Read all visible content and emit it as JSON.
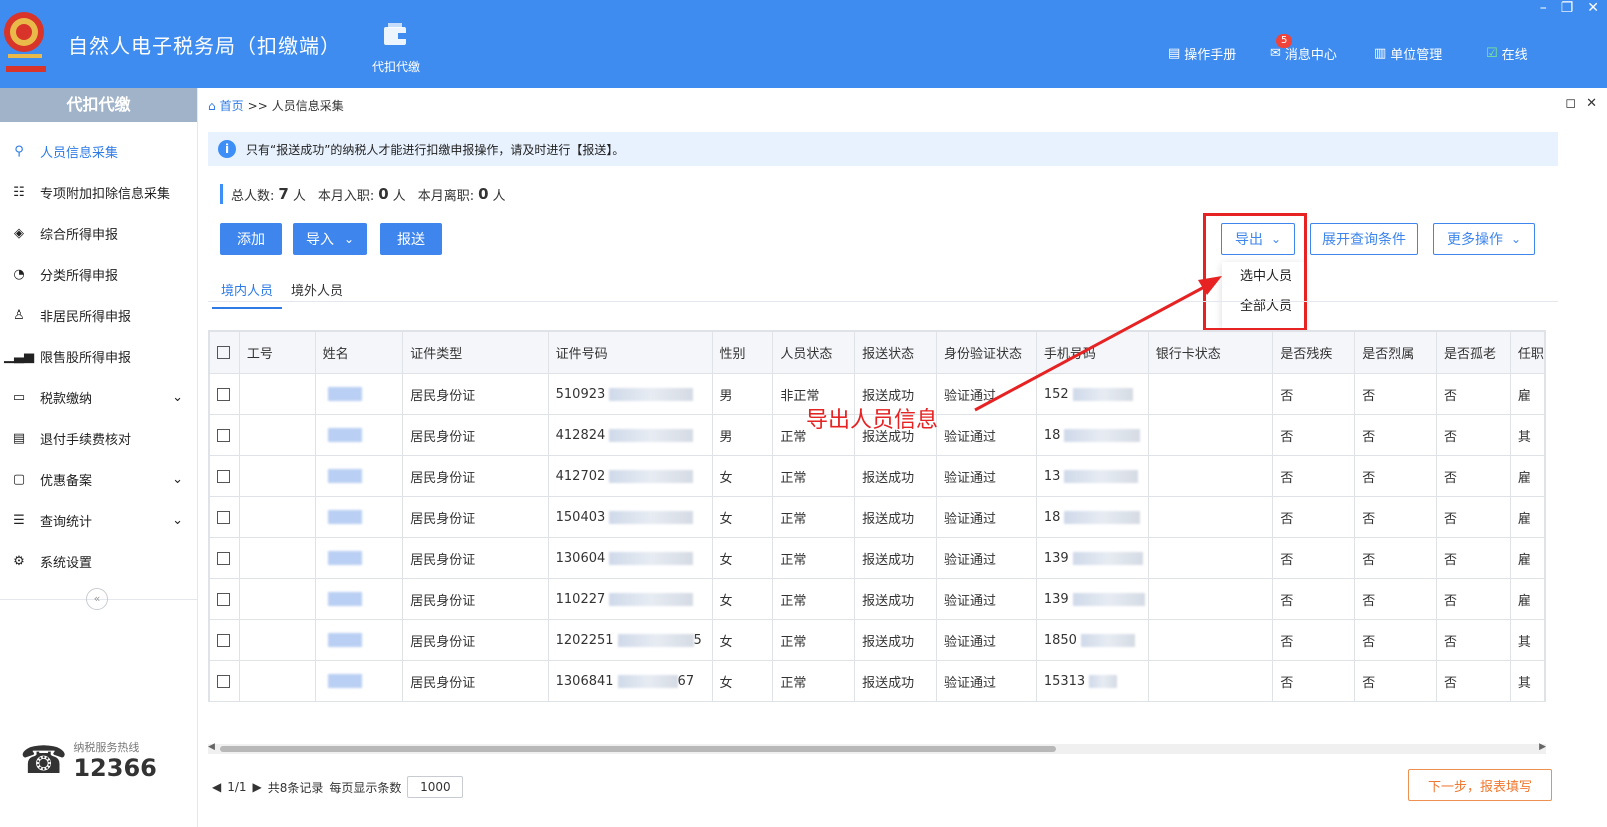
{
  "app": {
    "title": "自然人电子税务局（扣缴端）",
    "top_nav_label": "代扣代缴",
    "manual": "操作手册",
    "messages": "消息中心",
    "messages_badge": "5",
    "unit_mgmt": "单位管理",
    "online": "在线"
  },
  "sidebar": {
    "title": "代扣代缴",
    "items": [
      {
        "label": "人员信息采集"
      },
      {
        "label": "专项附加扣除信息采集"
      },
      {
        "label": "综合所得申报"
      },
      {
        "label": "分类所得申报"
      },
      {
        "label": "非居民所得申报"
      },
      {
        "label": "限售股所得申报"
      },
      {
        "label": "税款缴纳"
      },
      {
        "label": "退付手续费核对"
      },
      {
        "label": "优惠备案"
      },
      {
        "label": "查询统计"
      },
      {
        "label": "系统设置"
      }
    ],
    "hotline_label": "纳税服务热线",
    "hotline_number": "12366"
  },
  "breadcrumb": {
    "home": "首页",
    "sep": ">>",
    "current": "人员信息采集"
  },
  "notice": "只有“报送成功”的纳税人才能进行扣缴申报操作，请及时进行【报送】。",
  "stats": {
    "total_label": "总人数:",
    "total": "7",
    "hired_label": "本月入职:",
    "hired": "0",
    "left_label": "本月离职:",
    "left": "0",
    "unit": "人"
  },
  "toolbar": {
    "add": "添加",
    "import": "导入",
    "submit": "报送",
    "export": "导出",
    "expand_query": "展开查询条件",
    "more": "更多操作"
  },
  "export_menu": [
    "选中人员",
    "全部人员"
  ],
  "tabs": [
    "境内人员",
    "境外人员"
  ],
  "table": {
    "headers": [
      "工号",
      "姓名",
      "证件类型",
      "证件号码",
      "性别",
      "人员状态",
      "报送状态",
      "身份验证状态",
      "手机号码",
      "银行卡状态",
      "是否残疾",
      "是否烈属",
      "是否孤老",
      "任职"
    ],
    "rows": [
      {
        "id_type": "居民身份证",
        "id_no": "510923",
        "gender": "男",
        "status": "非正常",
        "submit": "报送成功",
        "verify": "验证通过",
        "phone": "152",
        "disabled": "否",
        "martyr": "否",
        "lonely": "否",
        "emp": "雇"
      },
      {
        "id_type": "居民身份证",
        "id_no": "412824",
        "gender": "男",
        "status": "正常",
        "submit": "报送成功",
        "verify": "验证通过",
        "phone": "18",
        "disabled": "否",
        "martyr": "否",
        "lonely": "否",
        "emp": "其"
      },
      {
        "id_type": "居民身份证",
        "id_no": "412702",
        "gender": "女",
        "status": "正常",
        "submit": "报送成功",
        "verify": "验证通过",
        "phone": "13",
        "disabled": "否",
        "martyr": "否",
        "lonely": "否",
        "emp": "雇"
      },
      {
        "id_type": "居民身份证",
        "id_no": "150403",
        "gender": "女",
        "status": "正常",
        "submit": "报送成功",
        "verify": "验证通过",
        "phone": "18",
        "disabled": "否",
        "martyr": "否",
        "lonely": "否",
        "emp": "雇"
      },
      {
        "id_type": "居民身份证",
        "id_no": "130604",
        "gender": "女",
        "status": "正常",
        "submit": "报送成功",
        "verify": "验证通过",
        "phone": "139",
        "disabled": "否",
        "martyr": "否",
        "lonely": "否",
        "emp": "雇"
      },
      {
        "id_type": "居民身份证",
        "id_no": "110227",
        "gender": "女",
        "status": "正常",
        "submit": "报送成功",
        "verify": "验证通过",
        "phone": "139",
        "disabled": "否",
        "martyr": "否",
        "lonely": "否",
        "emp": "雇"
      },
      {
        "id_type": "居民身份证",
        "id_no": "1202251",
        "id_tail": "5",
        "gender": "女",
        "status": "正常",
        "submit": "报送成功",
        "verify": "验证通过",
        "phone": "1850",
        "disabled": "否",
        "martyr": "否",
        "lonely": "否",
        "emp": "其"
      },
      {
        "id_type": "居民身份证",
        "id_no": "1306841",
        "id_tail": "67",
        "gender": "女",
        "status": "正常",
        "submit": "报送成功",
        "verify": "验证通过",
        "phone": "15313",
        "disabled": "否",
        "martyr": "否",
        "lonely": "否",
        "emp": "其"
      }
    ]
  },
  "pager": {
    "page": "1/1",
    "total": "共8条记录",
    "per_page_label": "每页显示条数",
    "per_page": "1000"
  },
  "next_step": "下一步，报表填写",
  "annotation": "导出人员信息",
  "colors": {
    "header_bg": "#3f8cf0",
    "primary": "#3e86ee",
    "annotation_red": "#e62222"
  }
}
